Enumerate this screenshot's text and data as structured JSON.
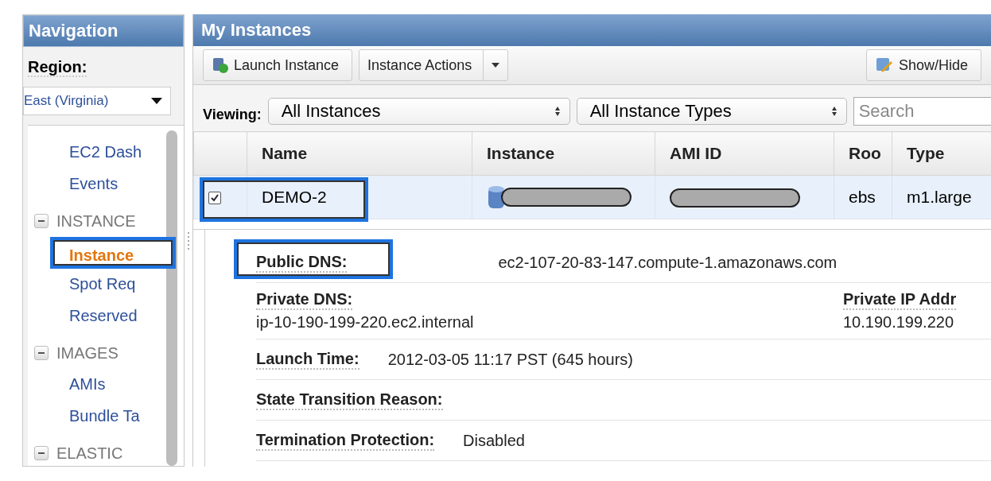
{
  "navigation": {
    "title": "Navigation",
    "region_label": "Region:",
    "region": "East (Virginia)",
    "items": [
      {
        "label": "EC2 Dash",
        "kind": "link",
        "selected": false,
        "highlighted": false
      },
      {
        "label": "Events",
        "kind": "link",
        "selected": false,
        "highlighted": false
      },
      {
        "label": "INSTANCE",
        "kind": "section",
        "expanded": true,
        "children": [
          {
            "label": "Instance",
            "kind": "link",
            "selected": true,
            "highlighted": true
          },
          {
            "label": "Spot Req",
            "kind": "link",
            "selected": false,
            "highlighted": false
          },
          {
            "label": "Reserved",
            "kind": "link",
            "selected": false,
            "highlighted": false
          }
        ]
      },
      {
        "label": "IMAGES",
        "kind": "section",
        "expanded": true,
        "children": [
          {
            "label": "AMIs",
            "kind": "link",
            "selected": false,
            "highlighted": false
          },
          {
            "label": "Bundle Ta",
            "kind": "link",
            "selected": false,
            "highlighted": false
          }
        ]
      },
      {
        "label": "ELASTIC",
        "kind": "section",
        "expanded": true
      }
    ]
  },
  "instances": {
    "title": "My Instances",
    "toolbar": [
      {
        "label": "Launch Instance",
        "kind": "launch"
      },
      {
        "label": "Instance Actions",
        "kind": "dropdown"
      },
      {
        "label": "Show/Hide",
        "kind": "showhide"
      }
    ],
    "viewing_label": "Viewing:",
    "filters": [
      "All Instances",
      "All Instance Types"
    ],
    "search": {
      "placeholder": "Search"
    },
    "columns": [
      "Name",
      "Instance",
      "AMI ID",
      "Roo",
      "Type"
    ],
    "rows": [
      {
        "checked": true,
        "selected": true,
        "highlighted": true,
        "cells": [
          {
            "kind": "text",
            "text": "DEMO-2"
          },
          {
            "kind": "redacted-instance"
          },
          {
            "kind": "redacted"
          },
          {
            "kind": "text",
            "text": "ebs"
          },
          {
            "kind": "text",
            "text": "m1.large"
          }
        ]
      }
    ],
    "details": [
      {
        "kind": "inline",
        "label": "Public DNS:",
        "value": "ec2-107-20-83-147.compute-1.amazonaws.com",
        "highlighted": true
      },
      {
        "kind": "pair",
        "items": [
          {
            "label": "Private DNS:",
            "value": "ip-10-190-199-220.ec2.internal"
          },
          {
            "label": "Private IP Addr",
            "value": "10.190.199.220"
          }
        ]
      },
      {
        "kind": "inline",
        "label": "Launch Time:",
        "value": "2012-03-05 11:17 PST (645 hours)",
        "highlighted": false
      },
      {
        "kind": "inline",
        "label": "State Transition Reason:",
        "highlighted": false
      },
      {
        "kind": "inline",
        "label": "Termination Protection:",
        "value": "Disabled",
        "highlighted": false
      }
    ]
  }
}
